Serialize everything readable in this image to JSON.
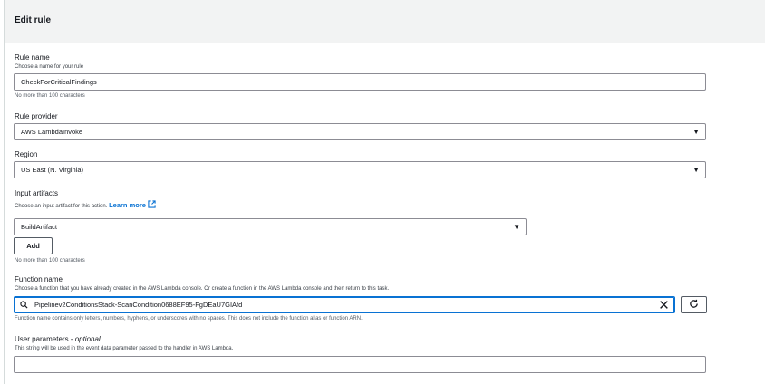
{
  "header": {
    "title": "Edit rule"
  },
  "rule_name": {
    "label": "Rule name",
    "description": "Choose a name for your rule",
    "value": "CheckForCriticalFindings",
    "constraint": "No more than 100 characters"
  },
  "rule_provider": {
    "label": "Rule provider",
    "value": "AWS LambdaInvoke"
  },
  "region": {
    "label": "Region",
    "value": "US East (N. Virginia)"
  },
  "input_artifacts": {
    "label": "Input artifacts",
    "description": "Choose an input artifact for this action.",
    "learn_more": "Learn more",
    "value": "BuildArtifact",
    "add_label": "Add",
    "constraint": "No more than 100 characters"
  },
  "function_name": {
    "label": "Function name",
    "description": "Choose a function that you have already created in the AWS Lambda console. Or create a function in the AWS Lambda console and then return to this task.",
    "value": "Pipelinev2ConditionsStack-ScanCondition0688EF95-FgDEaU7GIAfd",
    "constraint": "Function name contains only letters, numbers, hyphens, or underscores with no spaces. This does not include the function alias or function ARN."
  },
  "user_parameters": {
    "label": "User parameters",
    "optional": "optional",
    "description": "This string will be used in the event data parameter passed to the handler in AWS Lambda.",
    "value": ""
  },
  "colors": {
    "accent": "#0972d3",
    "text": "#16191f",
    "border": "#8c8c94"
  }
}
